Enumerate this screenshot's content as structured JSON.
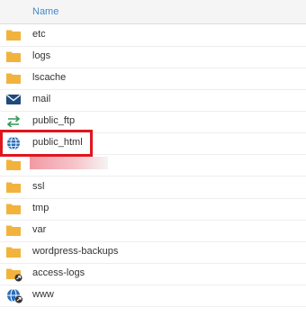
{
  "colors": {
    "accent": "#428bca",
    "folder": "#f2b33d",
    "highlight": "#e0161d",
    "redaction": "#f29aa3"
  },
  "header": {
    "name_label": "Name"
  },
  "rows": [
    {
      "label": "etc",
      "icon": "folder-icon"
    },
    {
      "label": "logs",
      "icon": "folder-icon"
    },
    {
      "label": "lscache",
      "icon": "folder-icon"
    },
    {
      "label": "mail",
      "icon": "envelope-icon"
    },
    {
      "label": "public_ftp",
      "icon": "transfer-arrows-icon"
    },
    {
      "label": "public_html",
      "icon": "globe-icon"
    },
    {
      "label": "",
      "icon": "folder-icon",
      "redacted": true
    },
    {
      "label": "ssl",
      "icon": "folder-icon"
    },
    {
      "label": "tmp",
      "icon": "folder-icon"
    },
    {
      "label": "var",
      "icon": "folder-icon"
    },
    {
      "label": "wordpress-backups",
      "icon": "folder-icon"
    },
    {
      "label": "access-logs",
      "icon": "folder-link-icon"
    },
    {
      "label": "www",
      "icon": "globe-link-icon"
    }
  ]
}
